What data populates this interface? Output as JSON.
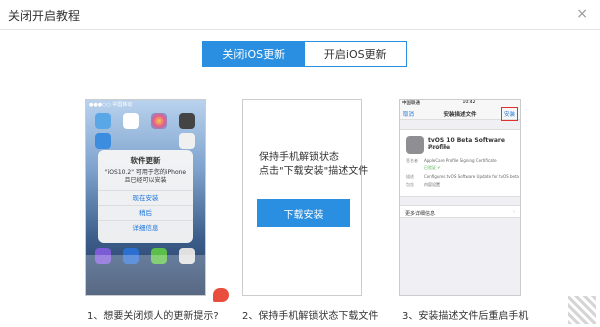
{
  "window": {
    "title": "关闭开启教程",
    "close_glyph": "×"
  },
  "tabs": [
    {
      "label": "关闭iOS更新",
      "active": true
    },
    {
      "label": "开启iOS更新",
      "active": false
    }
  ],
  "panel1": {
    "status": "●●●○○ 中国移动",
    "dialog": {
      "title": "软件更新",
      "message": "\"iOS10.2\" 可用于您的iPhone且已经可以安装",
      "buttons": [
        "现在安装",
        "稍后",
        "详细信息"
      ]
    }
  },
  "panel2": {
    "line1": "保持手机解锁状态",
    "line2": "点击\"下载安装\"描述文件",
    "button": "下载安装"
  },
  "panel3": {
    "status_left": "中国联通",
    "status_time": "10:42",
    "nav_cancel": "取消",
    "nav_title": "安装描述文件",
    "nav_install": "安装",
    "profile_name": "tvOS 10 Beta Software Profile",
    "profile_org": "Apple Inc.",
    "rows": [
      {
        "k": "签名者",
        "v": "AppleCare Profile Signing Certificate"
      },
      {
        "k": "",
        "v": "已验证 ✔"
      },
      {
        "k": "描述",
        "v": "Configures tvOS Software Update for tvOS beta"
      },
      {
        "k": "包含",
        "v": "内容设置"
      }
    ],
    "more": "更多详细信息",
    "more_chev": "›"
  },
  "captions": [
    "1、想要关闭烦人的更新提示?",
    "2、保持手机解锁状态下载文件",
    "3、安装描述文件后重启手机"
  ],
  "colors": {
    "accent": "#2a8fe0",
    "highlight": "#e03030"
  }
}
